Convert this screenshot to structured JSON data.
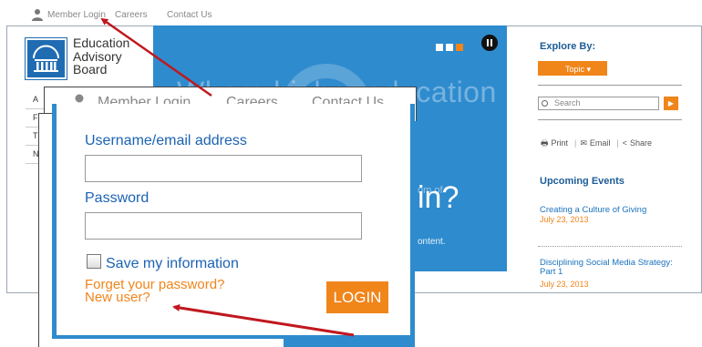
{
  "topbar": {
    "member_login": "Member Login",
    "careers": "Careers",
    "contact_us": "Contact Us"
  },
  "logo": {
    "line1": "Education",
    "line2": "Advisory",
    "line3": "Board"
  },
  "left_nav": {
    "items": [
      "A",
      "F",
      "T",
      "N"
    ]
  },
  "hero": {
    "headline_partial": "Where higher education",
    "tail_question": "in?",
    "tail_of": "om of",
    "tail_content": "ontent.",
    "slider_dots": 3,
    "active_dot": 3
  },
  "sidebar": {
    "explore_title": "Explore By:",
    "topic_label": "Topic",
    "topic_caret": "▾",
    "search_placeholder": "Search",
    "search_go": "▶",
    "share": {
      "print": "Print",
      "email": "Email",
      "share": "Share"
    },
    "events_title": "Upcoming Events",
    "events": [
      {
        "title": "Creating a Culture of Giving",
        "date": "July 23, 2013"
      },
      {
        "title": "Disciplining Social Media Strategy: Part 1",
        "date": "July 23, 2013"
      }
    ]
  },
  "callout": {
    "member_login": "Member Login",
    "careers": "Careers",
    "contact_us": "Contact Us",
    "username_label": "Username/email address",
    "username_value": "",
    "password_label": "Password",
    "password_value": "",
    "save_label": "Save my information",
    "forgot": "Forget your password?",
    "new_user": "New user?",
    "login_button": "LOGIN"
  },
  "colors": {
    "brand_blue": "#2e8bce",
    "heading_blue": "#1d5c97",
    "accent_orange": "#f0851a",
    "arrow_red": "#c0181e"
  }
}
